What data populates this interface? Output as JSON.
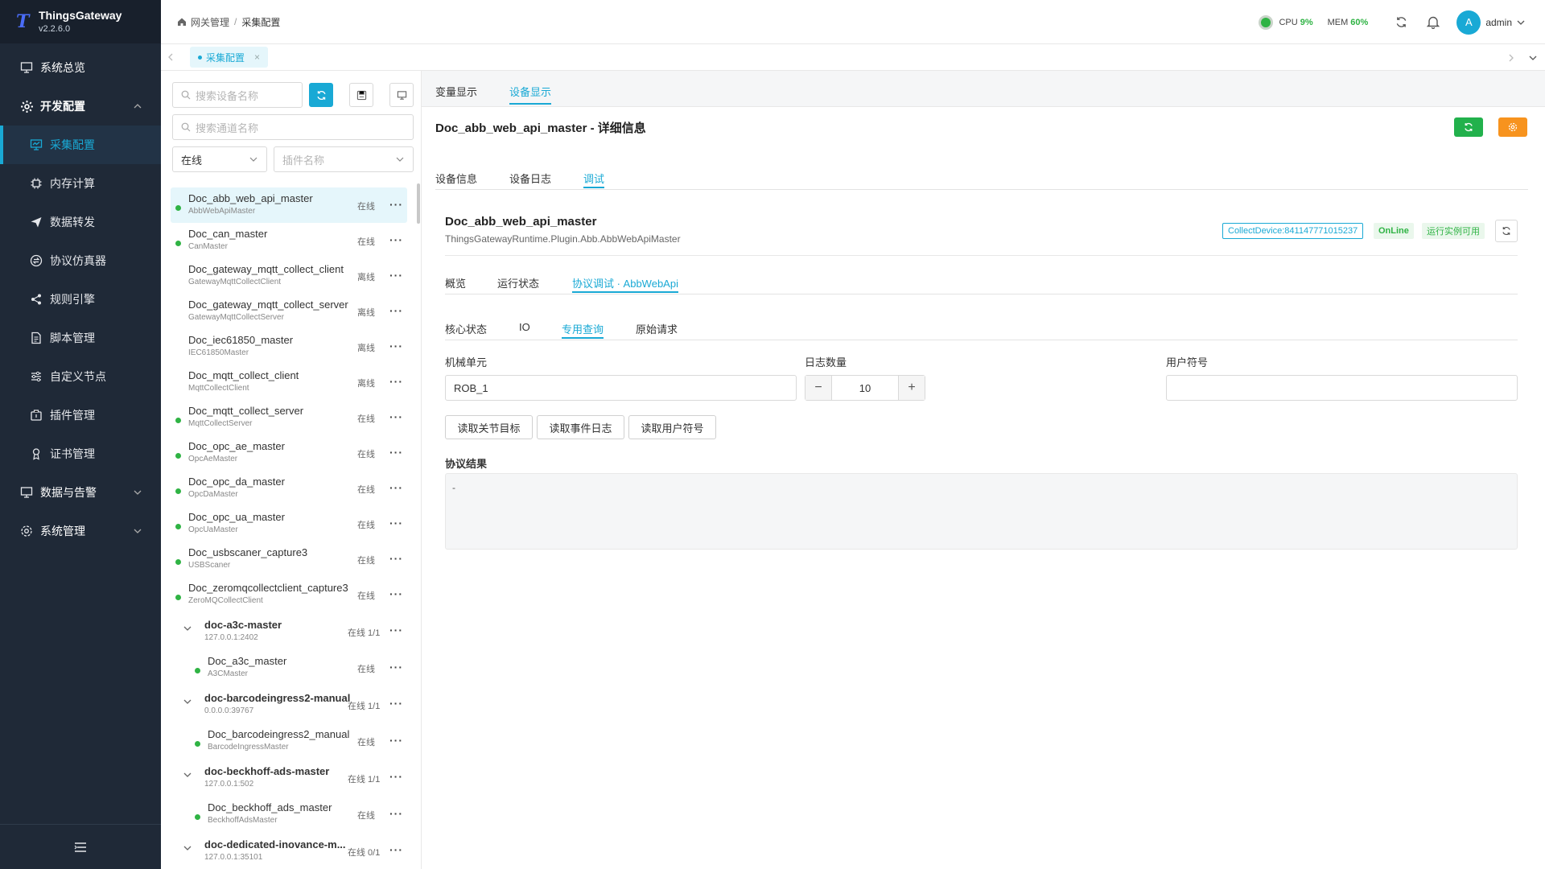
{
  "brand": {
    "name": "ThingsGateway",
    "version": "v2.2.6.0"
  },
  "sidebar": {
    "items": [
      {
        "label": "系统总览",
        "icon": "monitor-icon"
      },
      {
        "label": "开发配置",
        "icon": "gear-icon"
      },
      {
        "label": "采集配置",
        "icon": "chart-monitor-icon"
      },
      {
        "label": "内存计算",
        "icon": "chip-icon"
      },
      {
        "label": "数据转发",
        "icon": "send-icon"
      },
      {
        "label": "协议仿真器",
        "icon": "swap-icon"
      },
      {
        "label": "规则引擎",
        "icon": "share-icon"
      },
      {
        "label": "脚本管理",
        "icon": "file-icon"
      },
      {
        "label": "自定义节点",
        "icon": "sliders-icon"
      },
      {
        "label": "插件管理",
        "icon": "plugin-icon"
      },
      {
        "label": "证书管理",
        "icon": "certificate-icon"
      },
      {
        "label": "数据与告警",
        "icon": "monitor-icon"
      },
      {
        "label": "系统管理",
        "icon": "settings-icon"
      }
    ]
  },
  "header": {
    "breadcrumb": [
      "网关管理",
      "/",
      "采集配置"
    ],
    "cpu_label": "CPU",
    "cpu_value": "9%",
    "mem_label": "MEM",
    "mem_value": "60%",
    "avatar_letter": "A",
    "username": "admin"
  },
  "page_tabs": [
    {
      "label": "采集配置"
    }
  ],
  "left": {
    "search_device_placeholder": "搜索设备名称",
    "search_channel_placeholder": "搜索通道名称",
    "status_select": "在线",
    "plugin_placeholder": "插件名称"
  },
  "devices": [
    {
      "name": "Doc_abb_web_api_master",
      "plugin": "AbbWebApiMaster",
      "status": "在线",
      "online": true
    },
    {
      "name": "Doc_can_master",
      "plugin": "CanMaster",
      "status": "在线",
      "online": true
    },
    {
      "name": "Doc_gateway_mqtt_collect_client",
      "plugin": "GatewayMqttCollectClient",
      "status": "离线",
      "online": false
    },
    {
      "name": "Doc_gateway_mqtt_collect_server",
      "plugin": "GatewayMqttCollectServer",
      "status": "离线",
      "online": false
    },
    {
      "name": "Doc_iec61850_master",
      "plugin": "IEC61850Master",
      "status": "离线",
      "online": false
    },
    {
      "name": "Doc_mqtt_collect_client",
      "plugin": "MqttCollectClient",
      "status": "离线",
      "online": false
    },
    {
      "name": "Doc_mqtt_collect_server",
      "plugin": "MqttCollectServer",
      "status": "在线",
      "online": true
    },
    {
      "name": "Doc_opc_ae_master",
      "plugin": "OpcAeMaster",
      "status": "在线",
      "online": true
    },
    {
      "name": "Doc_opc_da_master",
      "plugin": "OpcDaMaster",
      "status": "在线",
      "online": true
    },
    {
      "name": "Doc_opc_ua_master",
      "plugin": "OpcUaMaster",
      "status": "在线",
      "online": true
    },
    {
      "name": "Doc_usbscaner_capture3",
      "plugin": "USBScaner",
      "status": "在线",
      "online": true
    },
    {
      "name": "Doc_zeromqcollectclient_capture3",
      "plugin": "ZeroMQCollectClient",
      "status": "在线",
      "online": true
    }
  ],
  "groups": [
    {
      "name": "doc-a3c-master",
      "addr": "127.0.0.1:2402",
      "status": "在线 1/1",
      "child": {
        "name": "Doc_a3c_master",
        "plugin": "A3CMaster",
        "status": "在线"
      }
    },
    {
      "name": "doc-barcodeingress2-manual",
      "addr": "0.0.0.0:39767",
      "status": "在线 1/1",
      "child": {
        "name": "Doc_barcodeingress2_manual",
        "plugin": "BarcodeIngressMaster",
        "status": "在线"
      }
    },
    {
      "name": "doc-beckhoff-ads-master",
      "addr": "127.0.0.1:502",
      "status": "在线 1/1",
      "child": {
        "name": "Doc_beckhoff_ads_master",
        "plugin": "BeckhoffAdsMaster",
        "status": "在线"
      }
    },
    {
      "name": "doc-dedicated-inovance-m...",
      "addr": "127.0.0.1:35101",
      "status": "在线 0/1"
    }
  ],
  "main": {
    "top_tabs": [
      "变量显示",
      "设备显示"
    ],
    "title": "Doc_abb_web_api_master - 详细信息",
    "sub_tabs": [
      "设备信息",
      "设备日志",
      "调试"
    ],
    "device_name": "Doc_abb_web_api_master",
    "device_plugin": "ThingsGatewayRuntime.Plugin.Abb.AbbWebApiMaster",
    "tag_collect": "CollectDevice:841147771015237",
    "tag_online": "OnLine",
    "tag_runtime": "运行实例可用",
    "proto_tabs": [
      "概览",
      "运行状态",
      "协议调试 · AbbWebApi"
    ],
    "inner_tabs": [
      "核心状态",
      "IO",
      "专用查询",
      "原始请求"
    ],
    "field_mech_label": "机械单元",
    "field_mech_value": "ROB_1",
    "field_log_label": "日志数量",
    "field_log_value": "10",
    "field_user_label": "用户符号",
    "field_user_value": "",
    "btn_read_joint": "读取关节目标",
    "btn_read_event": "读取事件日志",
    "btn_read_user": "读取用户符号",
    "result_label": "协议结果",
    "result_value": "-"
  },
  "colors": {
    "accent": "#19a9d5",
    "online": "#2fb344",
    "sidebar": "#1f2937",
    "refresh_btn": "#22b14c",
    "settings_btn": "#f7931e"
  }
}
